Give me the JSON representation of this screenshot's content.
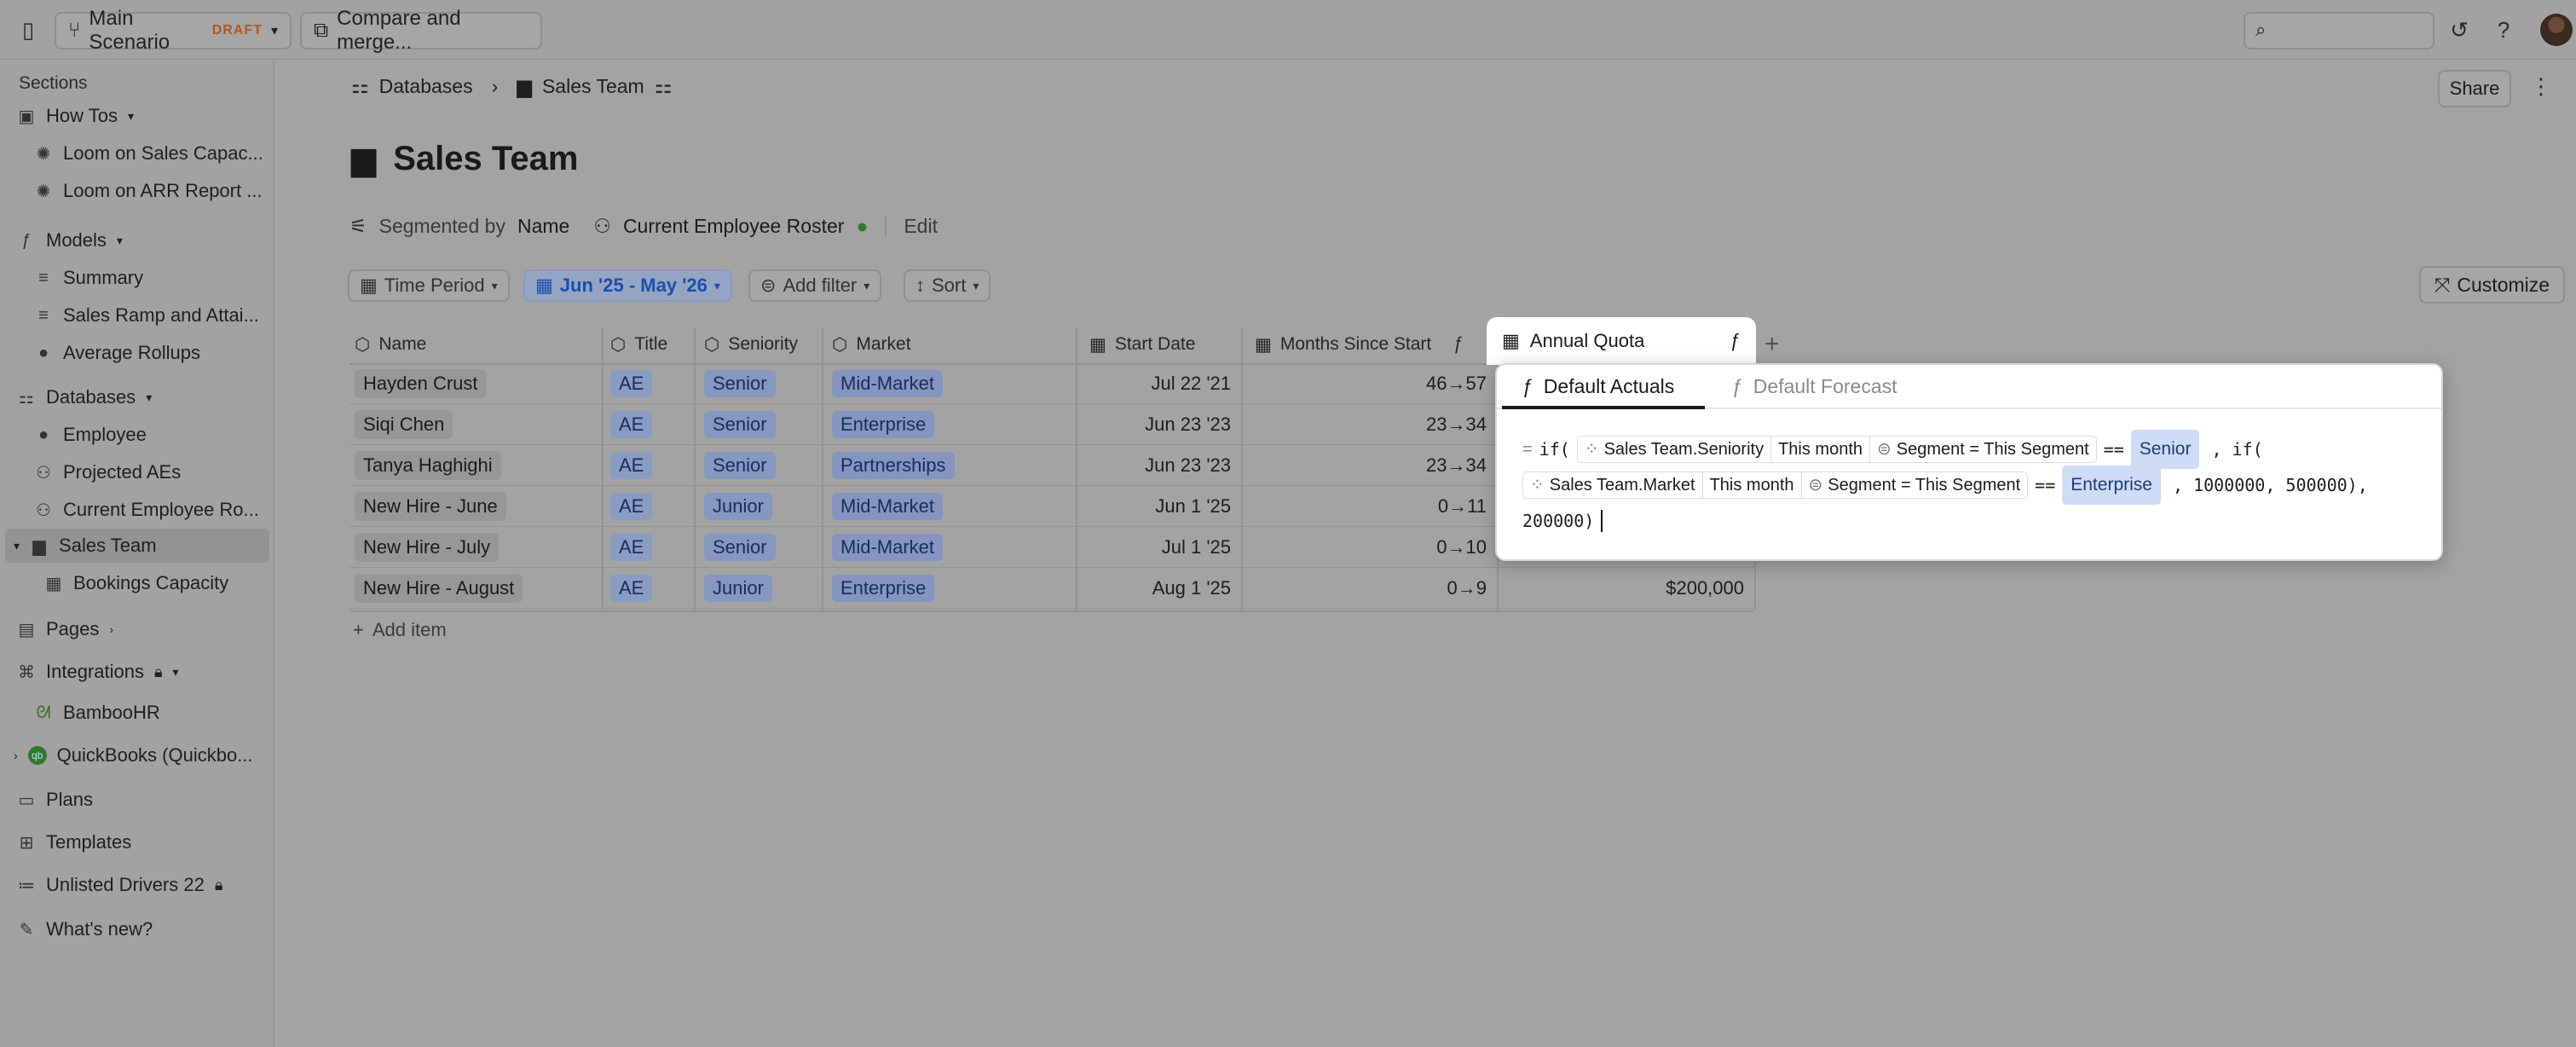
{
  "topbar": {
    "scenario": "Main Scenario",
    "draft": "DRAFT",
    "compare": "Compare and merge...",
    "search_placeholder": ""
  },
  "sidebar": {
    "sections_label": "Sections",
    "items": [
      {
        "label": "How Tos",
        "icon": "book-icon"
      },
      {
        "label": "Loom on Sales Capac...",
        "icon": "loom-icon"
      },
      {
        "label": "Loom on ARR Report ...",
        "icon": "loom-icon"
      },
      {
        "label": "Models",
        "icon": "function-icon"
      },
      {
        "label": "Summary",
        "icon": "model-icon"
      },
      {
        "label": "Sales Ramp and Attai...",
        "icon": "model-icon"
      },
      {
        "label": "Average Rollups",
        "icon": "check-circle-icon"
      },
      {
        "label": "Databases",
        "icon": "database-icon"
      },
      {
        "label": "Employee",
        "icon": "person-icon"
      },
      {
        "label": "Projected AEs",
        "icon": "people-icon"
      },
      {
        "label": "Current Employee Ro...",
        "icon": "people-icon"
      },
      {
        "label": "Sales Team",
        "icon": "bus-icon"
      },
      {
        "label": "Bookings Capacity",
        "icon": "table-icon"
      },
      {
        "label": "Pages",
        "icon": "page-icon"
      },
      {
        "label": "Integrations",
        "icon": "integration-icon"
      },
      {
        "label": "BambooHR",
        "icon": "bamboo-icon"
      },
      {
        "label": "QuickBooks (Quickbo...",
        "icon": "quickbooks-icon"
      },
      {
        "label": "Plans",
        "icon": "plans-icon"
      },
      {
        "label": "Templates",
        "icon": "templates-icon"
      },
      {
        "label": "Unlisted Drivers 22",
        "icon": "drivers-icon"
      },
      {
        "label": "What's new?",
        "icon": "sparkle-icon"
      }
    ]
  },
  "breadcrumb": {
    "root": "Databases",
    "current": "Sales Team"
  },
  "header": {
    "share": "Share",
    "title": "Sales Team"
  },
  "segment": {
    "label": "Segmented by",
    "field": "Name",
    "source": "Current Employee Roster",
    "edit": "Edit"
  },
  "filters": {
    "time_period": "Time Period",
    "range": "Jun '25 - May '26",
    "add_filter": "Add filter",
    "sort": "Sort",
    "customize": "Customize"
  },
  "table": {
    "columns": [
      "Name",
      "Title",
      "Seniority",
      "Market",
      "Start Date",
      "Months Since Start",
      "Annual Quota"
    ],
    "rows": [
      {
        "name": "Hayden Crust",
        "title": "AE",
        "seniority": "Senior",
        "market": "Mid-Market",
        "start": "Jul 22 '21",
        "months": "46→57",
        "quota": ""
      },
      {
        "name": "Siqi Chen",
        "title": "AE",
        "seniority": "Senior",
        "market": "Enterprise",
        "start": "Jun 23 '23",
        "months": "23→34",
        "quota": ""
      },
      {
        "name": "Tanya Haghighi",
        "title": "AE",
        "seniority": "Senior",
        "market": "Partnerships",
        "start": "Jun 23 '23",
        "months": "23→34",
        "quota": ""
      },
      {
        "name": "New Hire - June",
        "title": "AE",
        "seniority": "Junior",
        "market": "Mid-Market",
        "start": "Jun 1 '25",
        "months": "0→11",
        "quota": ""
      },
      {
        "name": "New Hire - July",
        "title": "AE",
        "seniority": "Senior",
        "market": "Mid-Market",
        "start": "Jul 1 '25",
        "months": "0→10",
        "quota": ""
      },
      {
        "name": "New Hire - August",
        "title": "AE",
        "seniority": "Junior",
        "market": "Enterprise",
        "start": "Aug 1 '25",
        "months": "0→9",
        "quota": "$200,000"
      }
    ],
    "add_item": "Add item"
  },
  "popover": {
    "tab_actuals": "Default Actuals",
    "tab_forecast": "Default Forecast",
    "formula": {
      "eq": "=",
      "if1": "if(",
      "ref1_field": "Sales Team.Seniority",
      "ref1_time": "This month",
      "ref1_filter": "Segment = This Segment",
      "op1": "==",
      "val1": "Senior",
      "comma_if": ", if(",
      "ref2_field": "Sales Team.Market",
      "ref2_time": "This month",
      "ref2_filter": "Segment = This Segment",
      "op2": "==",
      "val2": "Enterprise",
      "tail1": ", 1000000, 500000),",
      "tail2": "200000)"
    }
  }
}
